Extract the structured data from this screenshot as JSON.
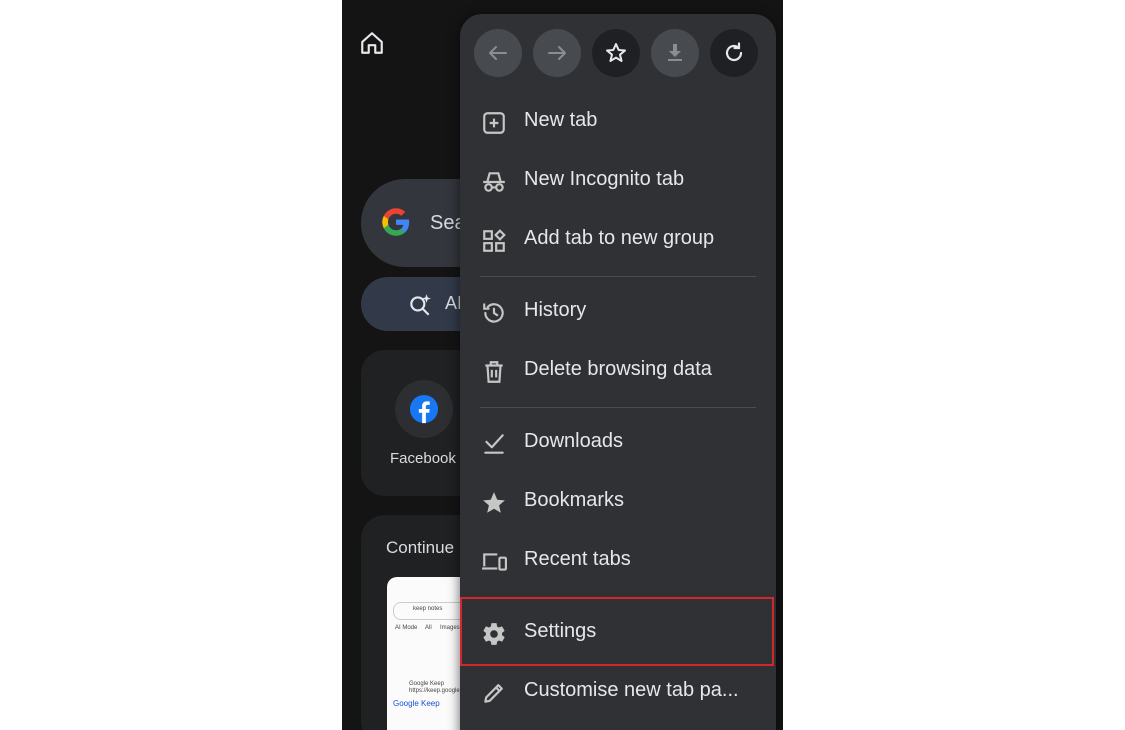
{
  "background_page": {
    "search_partial": "Sea",
    "ai_mode_partial": "AI",
    "shortcut_label": "Facebook",
    "continue_heading": "Continue",
    "thumbnail": {
      "search_query": "keep notes",
      "tabs": [
        "AI Mode",
        "All",
        "Images"
      ],
      "result_title": "Google Keep",
      "result_url": "https://keep.google.c...",
      "result_link": "Google Keep"
    }
  },
  "menu": {
    "nav": [
      "back-icon",
      "forward-icon",
      "star-icon",
      "download-icon",
      "refresh-icon"
    ],
    "items": [
      {
        "label": "New tab",
        "icon": "new-tab-icon"
      },
      {
        "label": "New Incognito tab",
        "icon": "incognito-icon"
      },
      {
        "label": "Add tab to new group",
        "icon": "tab-group-icon"
      },
      {
        "label": "History",
        "icon": "history-icon"
      },
      {
        "label": "Delete browsing data",
        "icon": "trash-icon"
      },
      {
        "label": "Downloads",
        "icon": "downloads-icon"
      },
      {
        "label": "Bookmarks",
        "icon": "bookmark-star-icon"
      },
      {
        "label": "Recent tabs",
        "icon": "devices-icon"
      },
      {
        "label": "Settings",
        "icon": "gear-icon"
      },
      {
        "label": "Customise new tab pa...",
        "icon": "pencil-icon"
      }
    ]
  },
  "colors": {
    "menu_bg": "#303134",
    "highlight_border": "#d2282d"
  }
}
